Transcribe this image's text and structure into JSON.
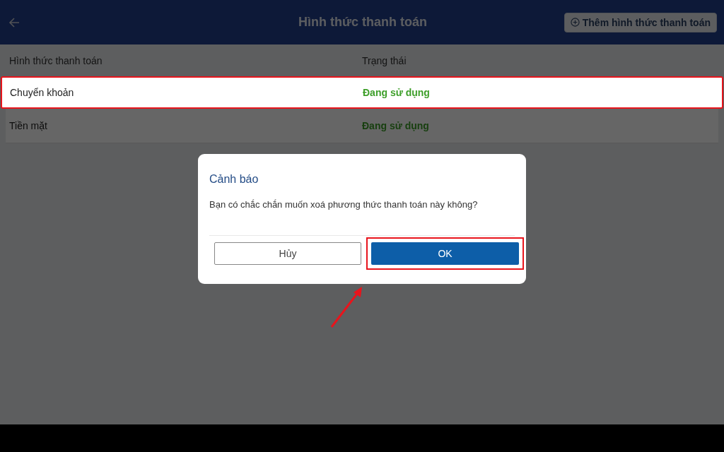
{
  "header": {
    "title": "Hình thức thanh toán",
    "add_button": "Thêm hình thức thanh toán"
  },
  "table": {
    "columns": [
      "Hình thức thanh toán",
      "Trạng thái"
    ],
    "rows": [
      {
        "name": "Chuyển khoản",
        "status": "Đang sử dụng",
        "highlighted": true
      },
      {
        "name": "Tiền mặt",
        "status": "Đang sử dụng",
        "highlighted": false
      }
    ]
  },
  "dialog": {
    "title": "Cảnh báo",
    "message": "Bạn có chắc chắn muốn xoá phương thức thanh toán này không?",
    "buttons": [
      {
        "label": "Hủy",
        "kind": "secondary",
        "highlighted": false
      },
      {
        "label": "OK",
        "kind": "primary",
        "highlighted": true
      }
    ]
  }
}
